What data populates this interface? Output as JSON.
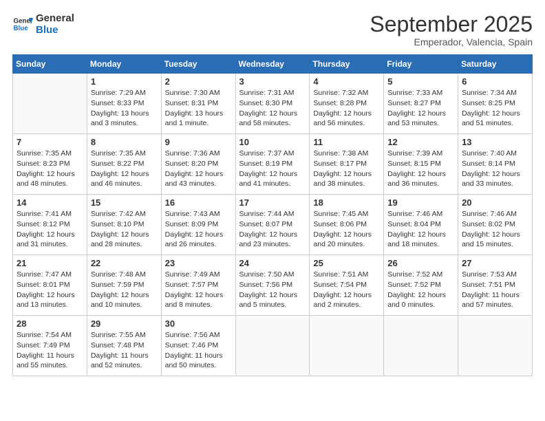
{
  "logo": {
    "general": "General",
    "blue": "Blue"
  },
  "header": {
    "month": "September 2025",
    "location": "Emperador, Valencia, Spain"
  },
  "weekdays": [
    "Sunday",
    "Monday",
    "Tuesday",
    "Wednesday",
    "Thursday",
    "Friday",
    "Saturday"
  ],
  "weeks": [
    [
      {
        "day": "",
        "info": ""
      },
      {
        "day": "1",
        "info": "Sunrise: 7:29 AM\nSunset: 8:33 PM\nDaylight: 13 hours\nand 3 minutes."
      },
      {
        "day": "2",
        "info": "Sunrise: 7:30 AM\nSunset: 8:31 PM\nDaylight: 13 hours\nand 1 minute."
      },
      {
        "day": "3",
        "info": "Sunrise: 7:31 AM\nSunset: 8:30 PM\nDaylight: 12 hours\nand 58 minutes."
      },
      {
        "day": "4",
        "info": "Sunrise: 7:32 AM\nSunset: 8:28 PM\nDaylight: 12 hours\nand 56 minutes."
      },
      {
        "day": "5",
        "info": "Sunrise: 7:33 AM\nSunset: 8:27 PM\nDaylight: 12 hours\nand 53 minutes."
      },
      {
        "day": "6",
        "info": "Sunrise: 7:34 AM\nSunset: 8:25 PM\nDaylight: 12 hours\nand 51 minutes."
      }
    ],
    [
      {
        "day": "7",
        "info": "Sunrise: 7:35 AM\nSunset: 8:23 PM\nDaylight: 12 hours\nand 48 minutes."
      },
      {
        "day": "8",
        "info": "Sunrise: 7:35 AM\nSunset: 8:22 PM\nDaylight: 12 hours\nand 46 minutes."
      },
      {
        "day": "9",
        "info": "Sunrise: 7:36 AM\nSunset: 8:20 PM\nDaylight: 12 hours\nand 43 minutes."
      },
      {
        "day": "10",
        "info": "Sunrise: 7:37 AM\nSunset: 8:19 PM\nDaylight: 12 hours\nand 41 minutes."
      },
      {
        "day": "11",
        "info": "Sunrise: 7:38 AM\nSunset: 8:17 PM\nDaylight: 12 hours\nand 38 minutes."
      },
      {
        "day": "12",
        "info": "Sunrise: 7:39 AM\nSunset: 8:15 PM\nDaylight: 12 hours\nand 36 minutes."
      },
      {
        "day": "13",
        "info": "Sunrise: 7:40 AM\nSunset: 8:14 PM\nDaylight: 12 hours\nand 33 minutes."
      }
    ],
    [
      {
        "day": "14",
        "info": "Sunrise: 7:41 AM\nSunset: 8:12 PM\nDaylight: 12 hours\nand 31 minutes."
      },
      {
        "day": "15",
        "info": "Sunrise: 7:42 AM\nSunset: 8:10 PM\nDaylight: 12 hours\nand 28 minutes."
      },
      {
        "day": "16",
        "info": "Sunrise: 7:43 AM\nSunset: 8:09 PM\nDaylight: 12 hours\nand 26 minutes."
      },
      {
        "day": "17",
        "info": "Sunrise: 7:44 AM\nSunset: 8:07 PM\nDaylight: 12 hours\nand 23 minutes."
      },
      {
        "day": "18",
        "info": "Sunrise: 7:45 AM\nSunset: 8:06 PM\nDaylight: 12 hours\nand 20 minutes."
      },
      {
        "day": "19",
        "info": "Sunrise: 7:46 AM\nSunset: 8:04 PM\nDaylight: 12 hours\nand 18 minutes."
      },
      {
        "day": "20",
        "info": "Sunrise: 7:46 AM\nSunset: 8:02 PM\nDaylight: 12 hours\nand 15 minutes."
      }
    ],
    [
      {
        "day": "21",
        "info": "Sunrise: 7:47 AM\nSunset: 8:01 PM\nDaylight: 12 hours\nand 13 minutes."
      },
      {
        "day": "22",
        "info": "Sunrise: 7:48 AM\nSunset: 7:59 PM\nDaylight: 12 hours\nand 10 minutes."
      },
      {
        "day": "23",
        "info": "Sunrise: 7:49 AM\nSunset: 7:57 PM\nDaylight: 12 hours\nand 8 minutes."
      },
      {
        "day": "24",
        "info": "Sunrise: 7:50 AM\nSunset: 7:56 PM\nDaylight: 12 hours\nand 5 minutes."
      },
      {
        "day": "25",
        "info": "Sunrise: 7:51 AM\nSunset: 7:54 PM\nDaylight: 12 hours\nand 2 minutes."
      },
      {
        "day": "26",
        "info": "Sunrise: 7:52 AM\nSunset: 7:52 PM\nDaylight: 12 hours\nand 0 minutes."
      },
      {
        "day": "27",
        "info": "Sunrise: 7:53 AM\nSunset: 7:51 PM\nDaylight: 11 hours\nand 57 minutes."
      }
    ],
    [
      {
        "day": "28",
        "info": "Sunrise: 7:54 AM\nSunset: 7:49 PM\nDaylight: 11 hours\nand 55 minutes."
      },
      {
        "day": "29",
        "info": "Sunrise: 7:55 AM\nSunset: 7:48 PM\nDaylight: 11 hours\nand 52 minutes."
      },
      {
        "day": "30",
        "info": "Sunrise: 7:56 AM\nSunset: 7:46 PM\nDaylight: 11 hours\nand 50 minutes."
      },
      {
        "day": "",
        "info": ""
      },
      {
        "day": "",
        "info": ""
      },
      {
        "day": "",
        "info": ""
      },
      {
        "day": "",
        "info": ""
      }
    ]
  ]
}
